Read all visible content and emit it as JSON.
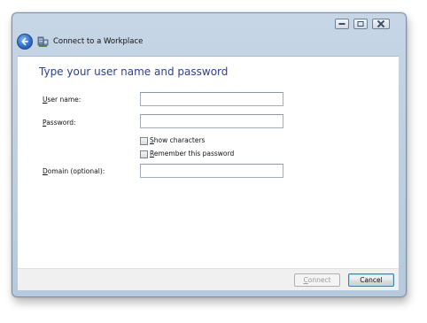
{
  "window": {
    "title": "Connect to a Workplace"
  },
  "page": {
    "heading": "Type your user name and password"
  },
  "form": {
    "username": {
      "label_accel": "U",
      "label_rest": "ser name:",
      "value": ""
    },
    "password": {
      "label_accel": "P",
      "label_rest": "assword:",
      "value": ""
    },
    "show_characters": {
      "label_accel": "S",
      "label_rest": "how characters",
      "checked": false
    },
    "remember_password": {
      "label_accel": "R",
      "label_rest": "emember this password",
      "checked": false
    },
    "domain": {
      "label_accel": "D",
      "label_rest": "omain (optional):",
      "value": ""
    }
  },
  "footer": {
    "connect_accel": "C",
    "connect_rest": "onnect",
    "cancel_label": "Cancel"
  },
  "icons": {
    "back": "back-arrow-icon",
    "app": "network-workplace-icon",
    "minimize": "minimize-icon",
    "maximize": "maximize-icon",
    "close": "close-icon"
  }
}
